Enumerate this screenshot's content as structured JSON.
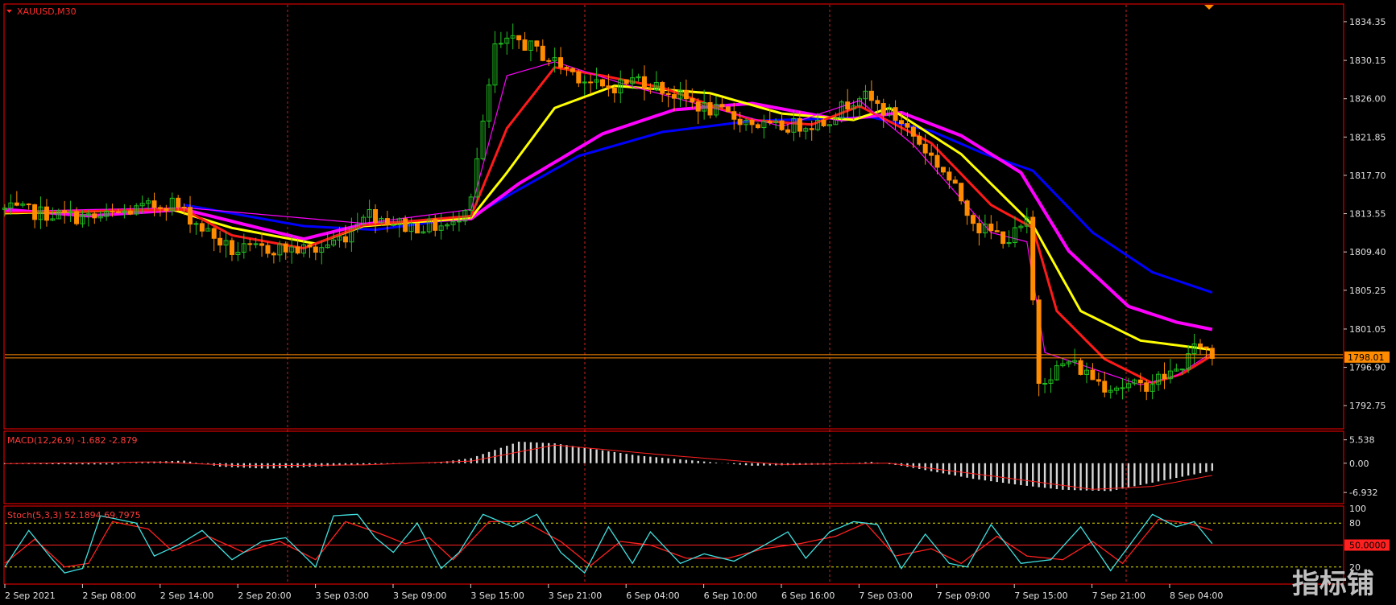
{
  "window": {
    "symbol_title": "XAUUSD,M30"
  },
  "watermark": "指标铺",
  "colors": {
    "background": "#000000",
    "frame": "#ff0000",
    "grid": "#cc2222",
    "bull": "#22c022",
    "bear": "#ff8c00",
    "ema_fast": "#ff00ff",
    "ema_red": "#ff1a1a",
    "ema_yellow": "#ffff00",
    "ema_magenta": "#ff00ff",
    "ema_blue": "#0000ff",
    "macd_hist": "#d8d8d8",
    "macd_signal": "#ff2020",
    "stoch_main": "#40e0e0",
    "stoch_signal": "#ff2020",
    "price_line": "#ff8c00",
    "price_label_bg": "#ff8c00"
  },
  "chart_data": [
    {
      "type": "candlestick",
      "name": "price",
      "ylim": [
        1790.5,
        1836.0
      ],
      "yticks": [
        "1834.35",
        "1830.15",
        "1826.00",
        "1821.85",
        "1817.70",
        "1813.55",
        "1809.40",
        "1805.25",
        "1801.05",
        "1796.90",
        "1792.75"
      ],
      "ytick_values": [
        1834.35,
        1830.15,
        1826.0,
        1821.85,
        1817.7,
        1813.55,
        1809.4,
        1805.25,
        1801.05,
        1796.9,
        1792.75
      ],
      "current_price": "1798.01",
      "current_price_value": 1798.01,
      "xticks": [
        "2 Sep 2021",
        "2 Sep 08:00",
        "2 Sep 14:00",
        "2 Sep 20:00",
        "3 Sep 03:00",
        "3 Sep 09:00",
        "3 Sep 15:00",
        "3 Sep 21:00",
        "6 Sep 04:00",
        "6 Sep 10:00",
        "6 Sep 16:00",
        "7 Sep 03:00",
        "7 Sep 09:00",
        "7 Sep 15:00",
        "7 Sep 21:00",
        "8 Sep 04:00"
      ],
      "bar_count": 224,
      "anchors": [
        [
          0,
          1814.0
        ],
        [
          15,
          1813.0
        ],
        [
          28,
          1814.8
        ],
        [
          33,
          1812.0
        ],
        [
          38,
          1809.5
        ],
        [
          45,
          1809.8
        ],
        [
          52,
          1809.6
        ],
        [
          57,
          1811.2
        ],
        [
          60,
          1813.8
        ],
        [
          67,
          1812.2
        ],
        [
          75,
          1812.2
        ],
        [
          78,
          1815.8
        ],
        [
          80,
          1823.0
        ],
        [
          82,
          1831.5
        ],
        [
          86,
          1832.3
        ],
        [
          92,
          1830.0
        ],
        [
          100,
          1827.0
        ],
        [
          106,
          1828.2
        ],
        [
          117,
          1825.0
        ],
        [
          128,
          1822.8
        ],
        [
          137,
          1823.5
        ],
        [
          143,
          1826.5
        ],
        [
          150,
          1823.5
        ],
        [
          157,
          1818.2
        ],
        [
          163,
          1812.0
        ],
        [
          168,
          1810.8
        ],
        [
          171,
          1812.5
        ],
        [
          173,
          1795.5
        ],
        [
          178,
          1797.5
        ],
        [
          184,
          1795.0
        ],
        [
          190,
          1794.8
        ],
        [
          196,
          1796.5
        ],
        [
          200,
          1799.5
        ],
        [
          202,
          1798.0
        ]
      ],
      "ema_lines": [
        {
          "color_key": "ema_fast",
          "anchors": [
            [
              0,
              1813.8
            ],
            [
              30,
              1814.2
            ],
            [
              60,
              1812.5
            ],
            [
              78,
              1814.0
            ],
            [
              84,
              1828.5
            ],
            [
              92,
              1830.0
            ],
            [
              104,
              1827.5
            ],
            [
              130,
              1823.0
            ],
            [
              143,
              1825.8
            ],
            [
              152,
              1821.0
            ],
            [
              165,
              1811.5
            ],
            [
              171,
              1810.5
            ],
            [
              174,
              1798.5
            ],
            [
              190,
              1795.0
            ],
            [
              196,
              1796.0
            ],
            [
              202,
              1798.5
            ]
          ]
        },
        {
          "color_key": "ema_red",
          "anchors": [
            [
              0,
              1813.7
            ],
            [
              30,
              1814.0
            ],
            [
              38,
              1811.2
            ],
            [
              50,
              1809.8
            ],
            [
              60,
              1812.3
            ],
            [
              78,
              1813.3
            ],
            [
              84,
              1822.8
            ],
            [
              92,
              1829.4
            ],
            [
              100,
              1828.5
            ],
            [
              110,
              1827.2
            ],
            [
              125,
              1823.7
            ],
            [
              135,
              1823.2
            ],
            [
              143,
              1825.2
            ],
            [
              155,
              1821.2
            ],
            [
              165,
              1814.5
            ],
            [
              172,
              1812.0
            ],
            [
              176,
              1803.0
            ],
            [
              184,
              1797.8
            ],
            [
              192,
              1795.2
            ],
            [
              197,
              1796.2
            ],
            [
              202,
              1798.2
            ]
          ]
        },
        {
          "color_key": "ema_yellow",
          "anchors": [
            [
              0,
              1813.6
            ],
            [
              28,
              1814.0
            ],
            [
              38,
              1812.0
            ],
            [
              52,
              1810.3
            ],
            [
              60,
              1812.2
            ],
            [
              78,
              1813.1
            ],
            [
              84,
              1818.0
            ],
            [
              92,
              1825.0
            ],
            [
              102,
              1827.4
            ],
            [
              118,
              1826.6
            ],
            [
              130,
              1824.4
            ],
            [
              142,
              1823.7
            ],
            [
              148,
              1825.0
            ],
            [
              160,
              1820.0
            ],
            [
              172,
              1812.3
            ],
            [
              180,
              1803.0
            ],
            [
              190,
              1799.8
            ],
            [
              202,
              1798.8
            ]
          ]
        },
        {
          "color_key": "ema_magenta",
          "anchors": [
            [
              0,
              1814.0
            ],
            [
              14,
              1813.3
            ],
            [
              30,
              1814.0
            ],
            [
              50,
              1810.8
            ],
            [
              60,
              1812.4
            ],
            [
              78,
              1813.0
            ],
            [
              86,
              1816.8
            ],
            [
              100,
              1822.2
            ],
            [
              112,
              1824.8
            ],
            [
              125,
              1825.5
            ],
            [
              140,
              1823.7
            ],
            [
              150,
              1824.5
            ],
            [
              160,
              1822.0
            ],
            [
              170,
              1818.0
            ],
            [
              178,
              1809.5
            ],
            [
              188,
              1803.5
            ],
            [
              196,
              1801.8
            ],
            [
              202,
              1801.0
            ]
          ]
        },
        {
          "color_key": "ema_blue",
          "anchors": [
            [
              30,
              1814.5
            ],
            [
              50,
              1812.2
            ],
            [
              62,
              1811.8
            ],
            [
              78,
              1813.2
            ],
            [
              85,
              1815.8
            ],
            [
              96,
              1819.8
            ],
            [
              110,
              1822.4
            ],
            [
              125,
              1823.6
            ],
            [
              145,
              1824.0
            ],
            [
              155,
              1822.5
            ],
            [
              164,
              1820.0
            ],
            [
              172,
              1818.2
            ],
            [
              182,
              1811.5
            ],
            [
              192,
              1807.2
            ],
            [
              202,
              1805.0
            ]
          ]
        }
      ]
    },
    {
      "type": "bar",
      "name": "MACD(12,26,9) -1.682 -2.879",
      "ylim": [
        -9.0,
        7.0
      ],
      "yticks": [
        "5.538",
        "0.00",
        "-6.932"
      ],
      "ytick_values": [
        5.538,
        0.0,
        -6.932
      ],
      "anchors": [
        [
          0,
          -0.2
        ],
        [
          18,
          -0.3
        ],
        [
          23,
          0.3
        ],
        [
          30,
          0.6
        ],
        [
          36,
          -0.8
        ],
        [
          44,
          -1.3
        ],
        [
          52,
          -0.8
        ],
        [
          60,
          -0.3
        ],
        [
          72,
          0.1
        ],
        [
          78,
          1.2
        ],
        [
          86,
          5.1
        ],
        [
          92,
          4.7
        ],
        [
          106,
          1.8
        ],
        [
          125,
          -0.6
        ],
        [
          138,
          -0.3
        ],
        [
          145,
          0.3
        ],
        [
          150,
          -0.6
        ],
        [
          162,
          -3.7
        ],
        [
          170,
          -5.2
        ],
        [
          177,
          -6.3
        ],
        [
          185,
          -6.6
        ],
        [
          192,
          -4.6
        ],
        [
          202,
          -1.8
        ]
      ],
      "signal_anchors": [
        [
          0,
          -0.1
        ],
        [
          25,
          0.3
        ],
        [
          40,
          -0.6
        ],
        [
          60,
          -0.4
        ],
        [
          78,
          0.5
        ],
        [
          92,
          4.3
        ],
        [
          110,
          2.0
        ],
        [
          130,
          -0.3
        ],
        [
          148,
          0.0
        ],
        [
          165,
          -3.0
        ],
        [
          182,
          -6.2
        ],
        [
          192,
          -5.5
        ],
        [
          202,
          -2.9
        ]
      ]
    },
    {
      "type": "line",
      "name": "Stoch(5,3,3) 52.1894 69.7975",
      "ylim": [
        0,
        100
      ],
      "yticks": [
        "100",
        "80",
        "50.0000",
        "20"
      ],
      "ytick_values": [
        100,
        80,
        50,
        20
      ],
      "levels": [
        80,
        50,
        20
      ],
      "anchors": [
        [
          0,
          20
        ],
        [
          4,
          70
        ],
        [
          8,
          30
        ],
        [
          10,
          12
        ],
        [
          13,
          18
        ],
        [
          16,
          90
        ],
        [
          22,
          80
        ],
        [
          25,
          35
        ],
        [
          29,
          50
        ],
        [
          33,
          70
        ],
        [
          38,
          30
        ],
        [
          43,
          55
        ],
        [
          47,
          60
        ],
        [
          52,
          20
        ],
        [
          55,
          90
        ],
        [
          59,
          92
        ],
        [
          62,
          60
        ],
        [
          65,
          40
        ],
        [
          69,
          80
        ],
        [
          73,
          18
        ],
        [
          76,
          40
        ],
        [
          80,
          92
        ],
        [
          85,
          75
        ],
        [
          89,
          92
        ],
        [
          93,
          40
        ],
        [
          97,
          12
        ],
        [
          101,
          75
        ],
        [
          105,
          25
        ],
        [
          108,
          68
        ],
        [
          113,
          25
        ],
        [
          117,
          38
        ],
        [
          122,
          28
        ],
        [
          126,
          45
        ],
        [
          131,
          68
        ],
        [
          134,
          32
        ],
        [
          138,
          68
        ],
        [
          142,
          82
        ],
        [
          146,
          78
        ],
        [
          150,
          18
        ],
        [
          154,
          65
        ],
        [
          158,
          25
        ],
        [
          161,
          20
        ],
        [
          165,
          78
        ],
        [
          170,
          25
        ],
        [
          175,
          30
        ],
        [
          180,
          75
        ],
        [
          185,
          15
        ],
        [
          192,
          92
        ],
        [
          196,
          75
        ],
        [
          199,
          82
        ],
        [
          202,
          52
        ]
      ],
      "signal_anchors": [
        [
          0,
          25
        ],
        [
          5,
          58
        ],
        [
          10,
          20
        ],
        [
          14,
          25
        ],
        [
          18,
          82
        ],
        [
          24,
          72
        ],
        [
          28,
          42
        ],
        [
          34,
          62
        ],
        [
          40,
          40
        ],
        [
          46,
          55
        ],
        [
          52,
          30
        ],
        [
          57,
          82
        ],
        [
          62,
          68
        ],
        [
          67,
          52
        ],
        [
          71,
          60
        ],
        [
          75,
          30
        ],
        [
          81,
          82
        ],
        [
          87,
          82
        ],
        [
          93,
          55
        ],
        [
          98,
          22
        ],
        [
          103,
          55
        ],
        [
          108,
          50
        ],
        [
          114,
          32
        ],
        [
          121,
          32
        ],
        [
          127,
          45
        ],
        [
          133,
          52
        ],
        [
          139,
          62
        ],
        [
          144,
          80
        ],
        [
          149,
          35
        ],
        [
          155,
          45
        ],
        [
          160,
          25
        ],
        [
          166,
          62
        ],
        [
          171,
          35
        ],
        [
          177,
          30
        ],
        [
          182,
          55
        ],
        [
          187,
          25
        ],
        [
          193,
          85
        ],
        [
          198,
          80
        ],
        [
          202,
          70
        ]
      ]
    }
  ]
}
